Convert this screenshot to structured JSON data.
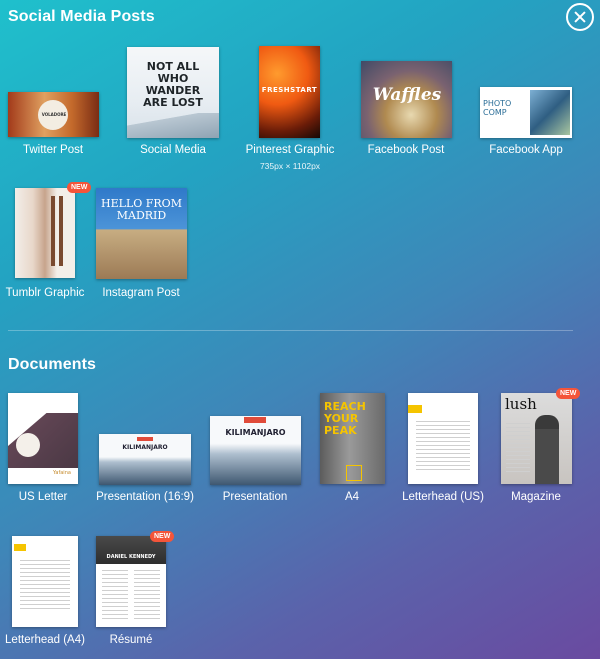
{
  "sections": {
    "social": {
      "title": "Social Media Posts"
    },
    "documents": {
      "title": "Documents"
    }
  },
  "badges": {
    "new": "NEW"
  },
  "social_items": [
    {
      "label": "Twitter Post",
      "thumb_text": "VOLADORE"
    },
    {
      "label": "Social Media",
      "thumb_text": "NOT ALL WHO WANDER ARE LOST"
    },
    {
      "label": "Pinterest Graphic",
      "dimensions": "735px × 1102px",
      "thumb_text": "FRESHSTART"
    },
    {
      "label": "Facebook Post",
      "thumb_text": "Waffles"
    },
    {
      "label": "Facebook App",
      "thumb_text": "PHOTO COMP"
    },
    {
      "label": "Tumblr Graphic",
      "badge": "NEW"
    },
    {
      "label": "Instagram Post",
      "thumb_text": "HELLO FROM MADRID"
    }
  ],
  "document_items": [
    {
      "label": "US Letter",
      "thumb_text": "Yafaina"
    },
    {
      "label": "Presentation (16:9)",
      "thumb_text": "KILIMANJARO"
    },
    {
      "label": "Presentation",
      "thumb_text": "KILIMANJARO"
    },
    {
      "label": "A4",
      "thumb_text": "REACH YOUR PEAK"
    },
    {
      "label": "Letterhead (US)"
    },
    {
      "label": "Magazine",
      "thumb_text": "lush",
      "badge": "NEW"
    },
    {
      "label": "Letterhead (A4)"
    },
    {
      "label": "Résumé",
      "thumb_text": "DANIEL KENNEDY",
      "badge": "NEW"
    }
  ],
  "colors": {
    "badge": "#f4553a",
    "accent_yellow": "#f5c400"
  }
}
